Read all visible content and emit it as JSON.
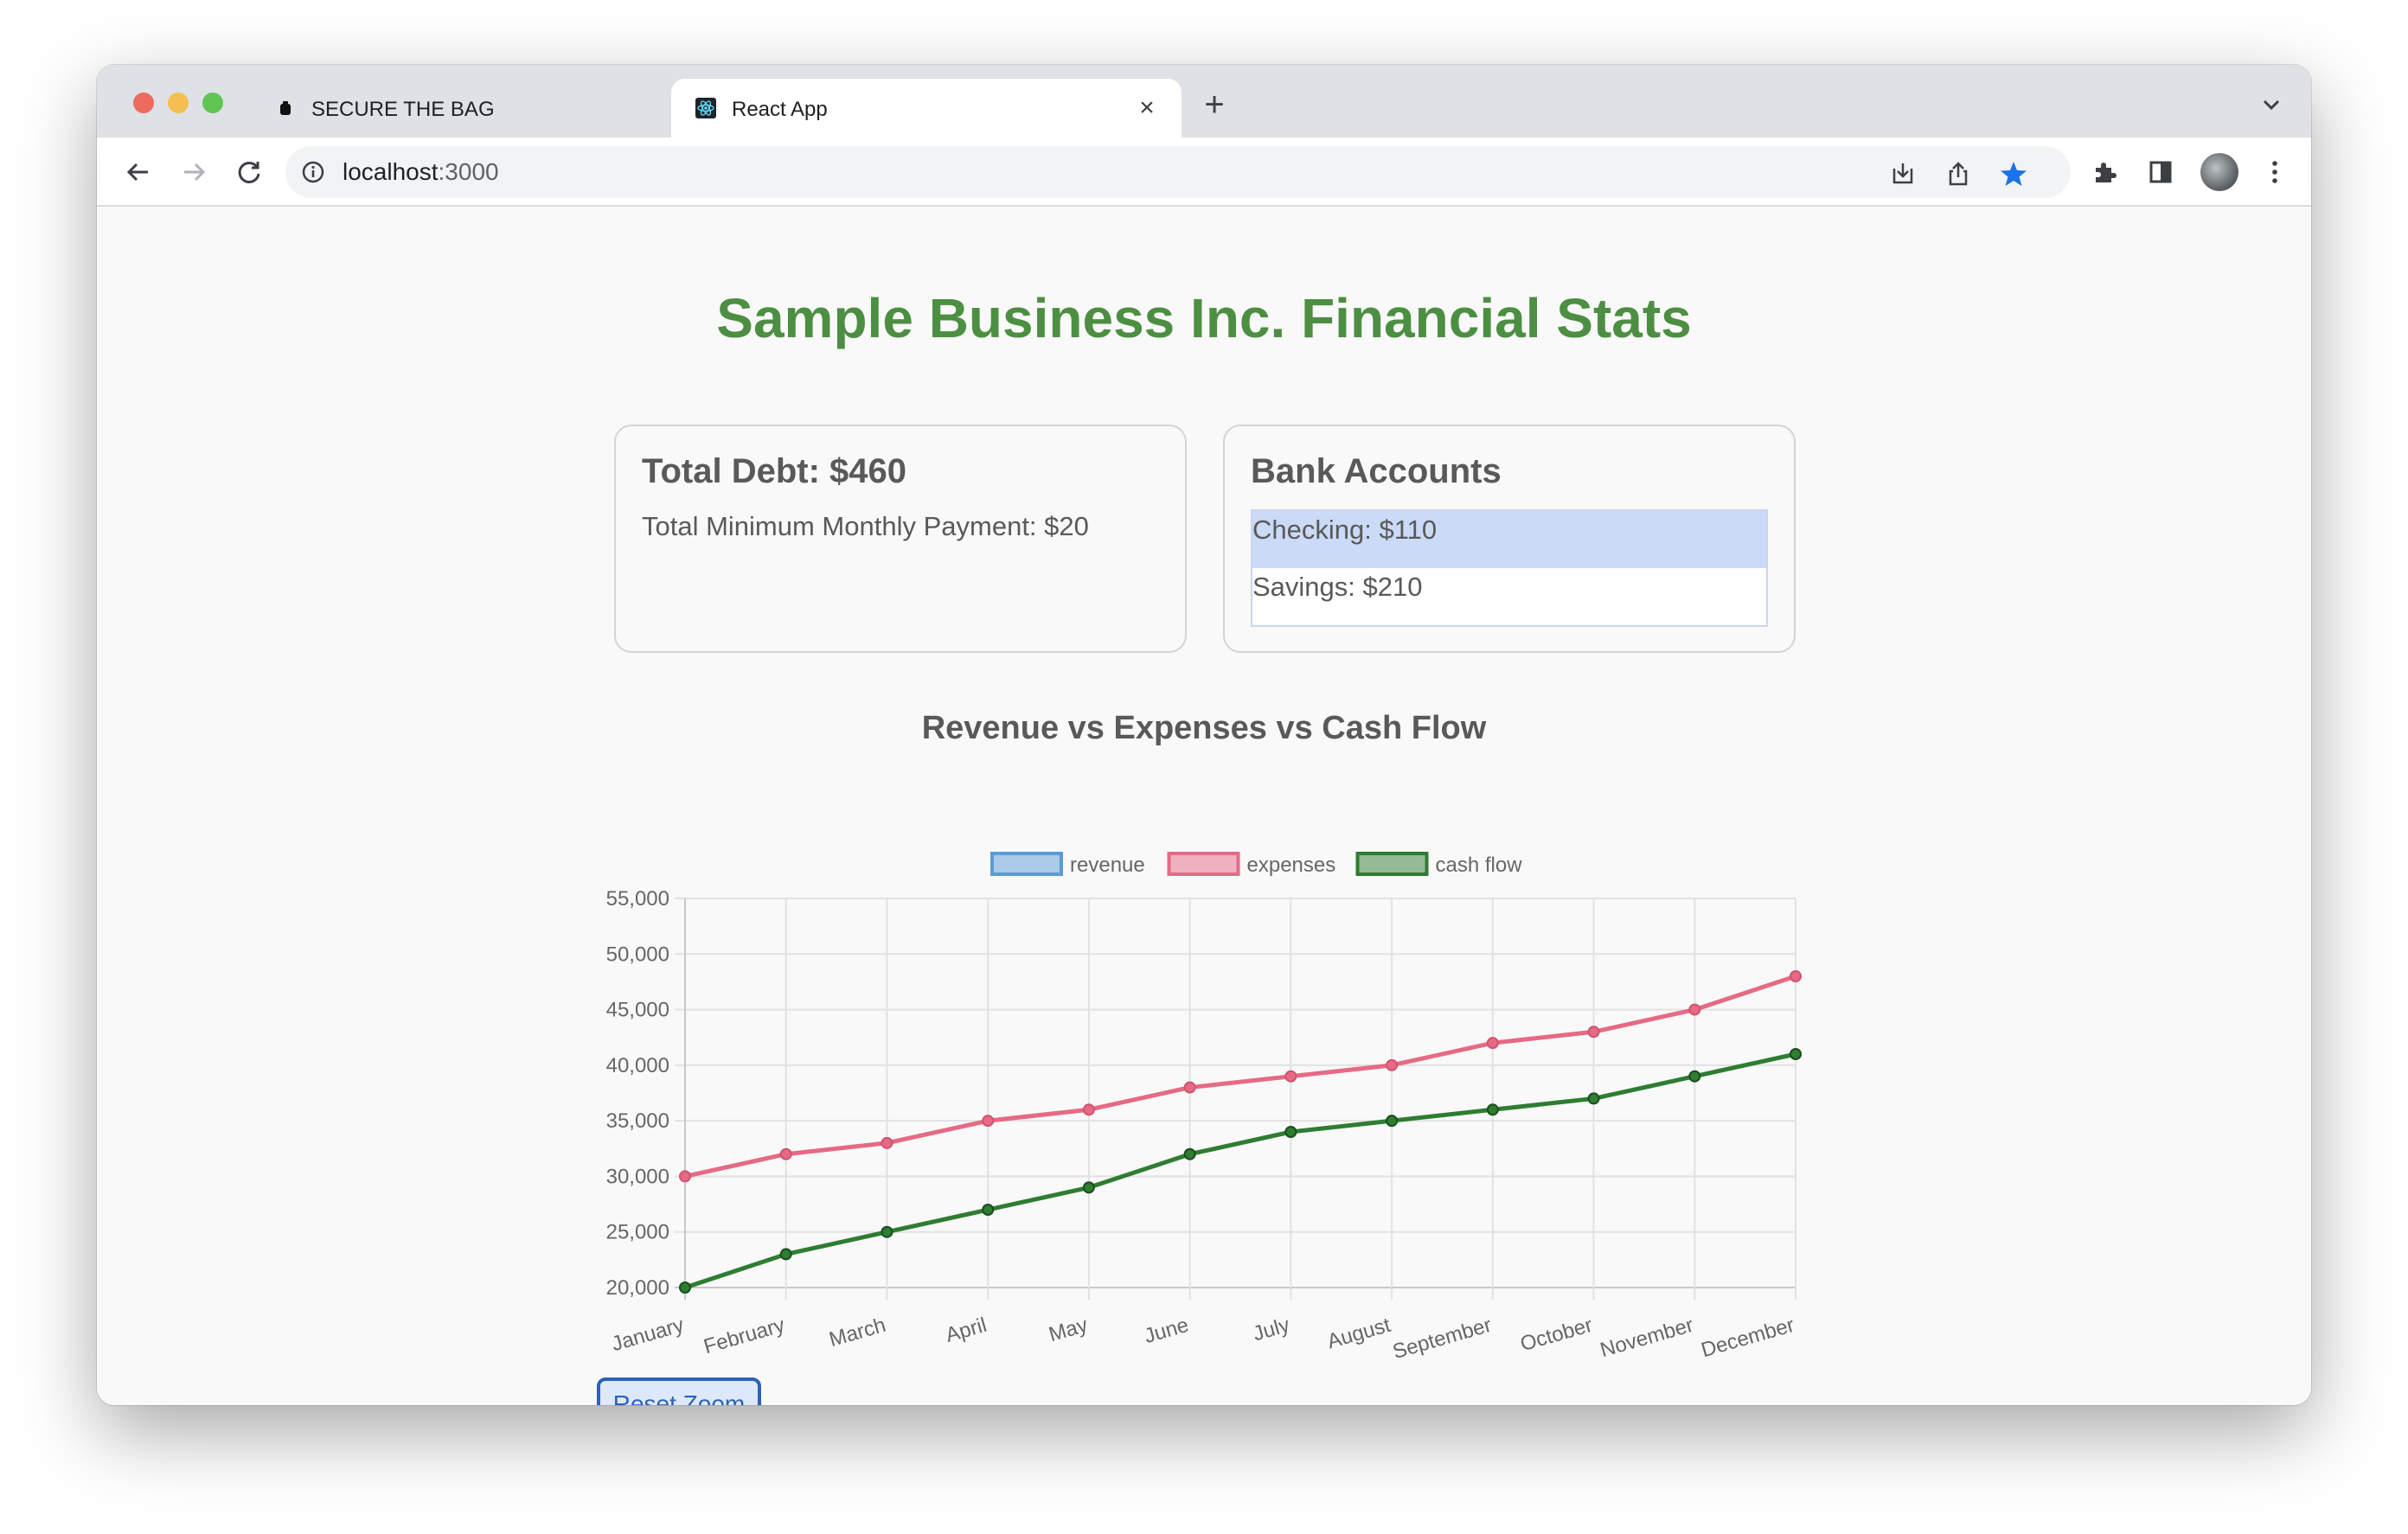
{
  "browser": {
    "tabs": [
      {
        "title": "SECURE THE BAG",
        "active": false
      },
      {
        "title": "React App",
        "active": true
      }
    ],
    "url": {
      "host": "localhost",
      "port": ":3000"
    }
  },
  "page": {
    "title": "Sample Business Inc. Financial Stats",
    "debt": {
      "heading": "Total Debt: $460",
      "min_payment": "Total Minimum Monthly Payment: $20"
    },
    "bank": {
      "heading": "Bank Accounts",
      "accounts": [
        {
          "label": "Checking: $110",
          "selected": true
        },
        {
          "label": "Savings: $210",
          "selected": false
        }
      ]
    },
    "chart_title": "Revenue vs Expenses vs Cash Flow",
    "reset_zoom_label": "Reset Zoom"
  },
  "colors": {
    "title_green": "#4d8f42",
    "revenue": "#5b9bd5",
    "expenses": "#e66a85",
    "cash_flow": "#2e7d32"
  },
  "chart_data": {
    "type": "line",
    "title": "Revenue vs Expenses vs Cash Flow",
    "categories": [
      "January",
      "February",
      "March",
      "April",
      "May",
      "June",
      "July",
      "August",
      "September",
      "October",
      "November",
      "December"
    ],
    "series": [
      {
        "name": "revenue",
        "values": []
      },
      {
        "name": "expenses",
        "values": [
          30000,
          32000,
          33000,
          35000,
          36000,
          38000,
          39000,
          40000,
          42000,
          43000,
          45000,
          48000
        ]
      },
      {
        "name": "cash flow",
        "values": [
          20000,
          23000,
          25000,
          27000,
          29000,
          32000,
          34000,
          35000,
          36000,
          37000,
          39000,
          41000
        ]
      }
    ],
    "yticks": [
      "20,000",
      "25,000",
      "30,000",
      "35,000",
      "40,000",
      "45,000",
      "50,000",
      "55,000"
    ],
    "ylim": [
      20000,
      55000
    ],
    "grid": true,
    "legend": "top"
  }
}
